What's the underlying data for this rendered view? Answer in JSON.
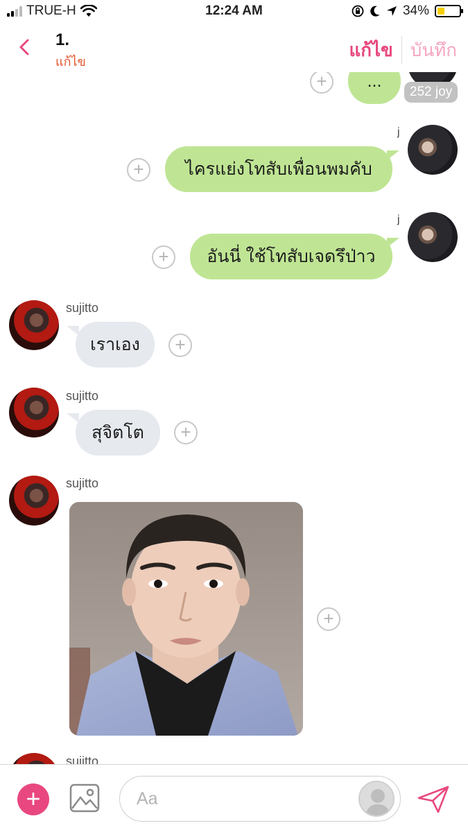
{
  "status_bar": {
    "carrier": "TRUE-H",
    "time": "12:24 AM",
    "battery": "34%",
    "icons": [
      "signal-icon",
      "wifi-icon",
      "orientation-lock-icon",
      "moon-icon",
      "location-icon",
      "battery-icon"
    ]
  },
  "header": {
    "title": "1.",
    "subtitle": "แก้ไข",
    "edit_label": "แก้ไข",
    "save_label": "บันทึก",
    "accent": "#e8487f",
    "subtitle_color": "#e3562e"
  },
  "messages": [
    {
      "side": "right",
      "text": "...",
      "badge": "252 joy"
    },
    {
      "side": "right",
      "sender": "j",
      "text": "ไครแย่งโทสับเพื่อนพมคับ"
    },
    {
      "side": "right",
      "sender": "j",
      "text": "อันนี่ ใช้โทสับเจดรึป่าว"
    },
    {
      "side": "left",
      "sender": "sujitto",
      "text": "เราเอง"
    },
    {
      "side": "left",
      "sender": "sujitto",
      "text": "สุจิตโต"
    },
    {
      "side": "left",
      "sender": "sujitto",
      "type": "photo"
    },
    {
      "side": "left",
      "sender": "sujitto"
    }
  ],
  "composer": {
    "placeholder": "Aa"
  },
  "colors": {
    "outgoing_bubble": "#bfe594",
    "incoming_bubble": "#e6e9ee",
    "accent": "#e8487f"
  }
}
